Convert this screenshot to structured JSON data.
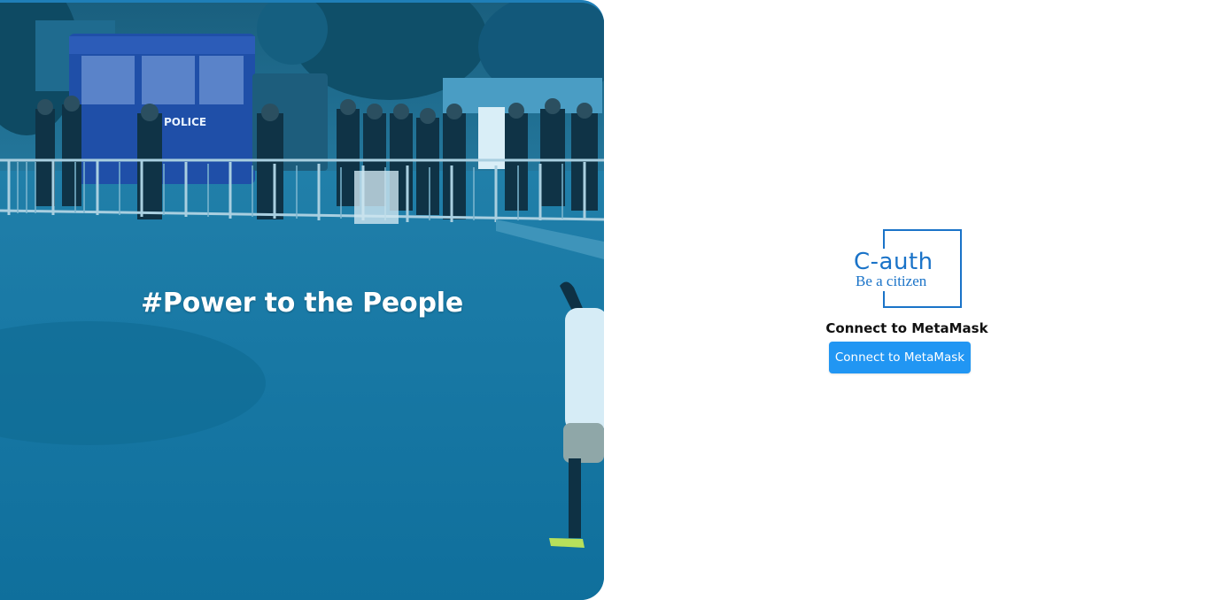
{
  "hero": {
    "slogan": "#Power to the People",
    "vehicle_label": "POLICE",
    "overlay_color": "#0f6f9c"
  },
  "logo": {
    "name": "C-auth",
    "tagline": "Be a citizen",
    "color": "#1a73c8"
  },
  "auth": {
    "heading": "Connect to MetaMask",
    "button_label": "Connect to MetaMask",
    "button_color": "#2196f3"
  }
}
